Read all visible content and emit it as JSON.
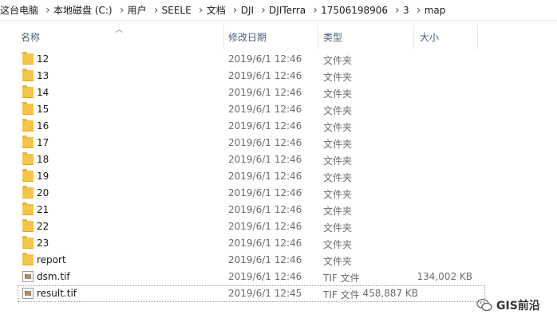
{
  "breadcrumb": [
    {
      "label": "这台电脑"
    },
    {
      "label": "本地磁盘 (C:)"
    },
    {
      "label": "用户"
    },
    {
      "label": "SEELE"
    },
    {
      "label": "文档"
    },
    {
      "label": "DJI"
    },
    {
      "label": "DJITerra"
    },
    {
      "label": "17506198906"
    },
    {
      "label": "3"
    },
    {
      "label": "map"
    }
  ],
  "columns": {
    "name": "名称",
    "date": "修改日期",
    "type": "类型",
    "size": "大小"
  },
  "files": [
    {
      "name": "12",
      "date": "2019/6/1 12:46",
      "type": "文件夹",
      "size": "",
      "icon": "folder-icon"
    },
    {
      "name": "13",
      "date": "2019/6/1 12:46",
      "type": "文件夹",
      "size": "",
      "icon": "folder-icon"
    },
    {
      "name": "14",
      "date": "2019/6/1 12:46",
      "type": "文件夹",
      "size": "",
      "icon": "folder-icon"
    },
    {
      "name": "15",
      "date": "2019/6/1 12:46",
      "type": "文件夹",
      "size": "",
      "icon": "folder-icon"
    },
    {
      "name": "16",
      "date": "2019/6/1 12:46",
      "type": "文件夹",
      "size": "",
      "icon": "folder-icon"
    },
    {
      "name": "17",
      "date": "2019/6/1 12:46",
      "type": "文件夹",
      "size": "",
      "icon": "folder-icon"
    },
    {
      "name": "18",
      "date": "2019/6/1 12:46",
      "type": "文件夹",
      "size": "",
      "icon": "folder-icon"
    },
    {
      "name": "19",
      "date": "2019/6/1 12:46",
      "type": "文件夹",
      "size": "",
      "icon": "folder-icon"
    },
    {
      "name": "20",
      "date": "2019/6/1 12:46",
      "type": "文件夹",
      "size": "",
      "icon": "folder-icon"
    },
    {
      "name": "21",
      "date": "2019/6/1 12:46",
      "type": "文件夹",
      "size": "",
      "icon": "folder-icon"
    },
    {
      "name": "22",
      "date": "2019/6/1 12:46",
      "type": "文件夹",
      "size": "",
      "icon": "folder-icon"
    },
    {
      "name": "23",
      "date": "2019/6/1 12:46",
      "type": "文件夹",
      "size": "",
      "icon": "folder-icon"
    },
    {
      "name": "report",
      "date": "2019/6/1 12:46",
      "type": "文件夹",
      "size": "",
      "icon": "folder-icon"
    },
    {
      "name": "dsm.tif",
      "date": "2019/6/1 12:46",
      "type": "TIF 文件",
      "size": "134,002 KB",
      "icon": "tif-file-icon"
    },
    {
      "name": "result.tif",
      "date": "2019/6/1 12:45",
      "type": "TIF 文件",
      "size": "458,887 KB",
      "icon": "tif-file-icon",
      "focused": true
    }
  ],
  "watermark": {
    "text": "GIS前沿",
    "icon": "wechat-icon"
  },
  "colors": {
    "folder": "#f5c44a",
    "header_text": "#4c607a",
    "secondary_text": "#6d6d6d"
  }
}
